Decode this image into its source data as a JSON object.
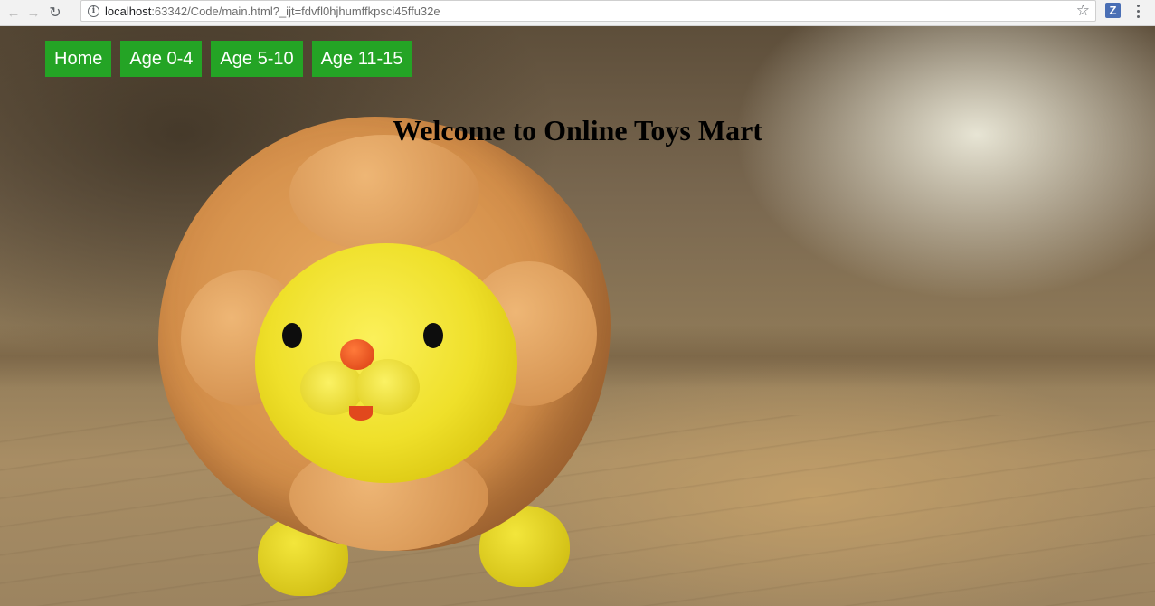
{
  "browser": {
    "url_host": "localhost",
    "url_rest": ":63342/Code/main.html?_ijt=fdvfl0hjhumffkpsci45ffu32e",
    "icons": {
      "back": "back-arrow-icon",
      "forward": "forward-arrow-icon",
      "reload": "reload-icon",
      "info": "info-icon",
      "star": "bookmark-star-icon",
      "extension": "extension-z-icon",
      "menu": "kebab-menu-icon"
    },
    "extension_letter": "Z"
  },
  "nav": {
    "items": [
      {
        "label": "Home"
      },
      {
        "label": "Age 0-4"
      },
      {
        "label": "Age 5-10"
      },
      {
        "label": "Age 11-15"
      }
    ],
    "color": "#24a425"
  },
  "main": {
    "heading": "Welcome to Online Toys Mart",
    "hero_image": "plush-lion-toy"
  }
}
